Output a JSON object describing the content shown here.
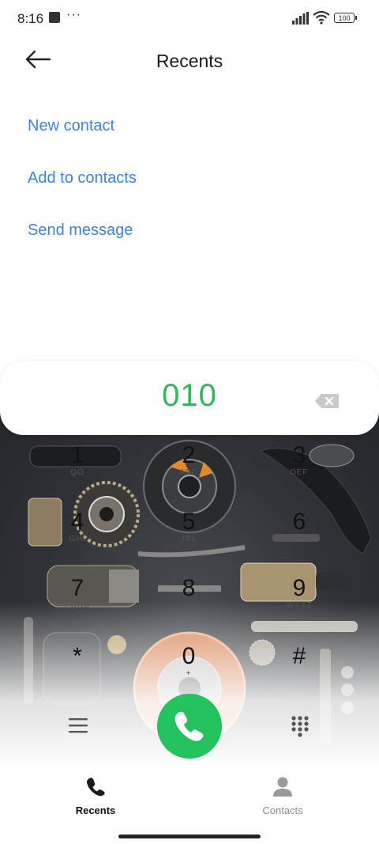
{
  "status_bar": {
    "time": "8:16",
    "more": "···",
    "battery": "100"
  },
  "header": {
    "title": "Recents"
  },
  "actions": [
    {
      "label": "New contact"
    },
    {
      "label": "Add to contacts"
    },
    {
      "label": "Send message"
    }
  ],
  "dialer": {
    "number": "010",
    "keys": [
      {
        "digit": "1",
        "letters": "QO"
      },
      {
        "digit": "2",
        "letters": "ABC"
      },
      {
        "digit": "3",
        "letters": "DEF"
      },
      {
        "digit": "4",
        "letters": "GHI"
      },
      {
        "digit": "5",
        "letters": "JKL"
      },
      {
        "digit": "6",
        "letters": "MNO"
      },
      {
        "digit": "7",
        "letters": "PQRS"
      },
      {
        "digit": "8",
        "letters": "TUV"
      },
      {
        "digit": "9",
        "letters": "WXYZ"
      },
      {
        "digit": "*",
        "letters": ""
      },
      {
        "digit": "0",
        "letters": "+"
      },
      {
        "digit": "#",
        "letters": ""
      }
    ]
  },
  "colors": {
    "accent_blue": "#3b82e8",
    "dial_green": "#2fb85a",
    "call_green": "#22c25c"
  },
  "nav": {
    "recents": {
      "label": "Recents",
      "icon": "phone-icon",
      "active": true
    },
    "contacts": {
      "label": "Contacts",
      "icon": "person-icon",
      "active": false
    }
  }
}
